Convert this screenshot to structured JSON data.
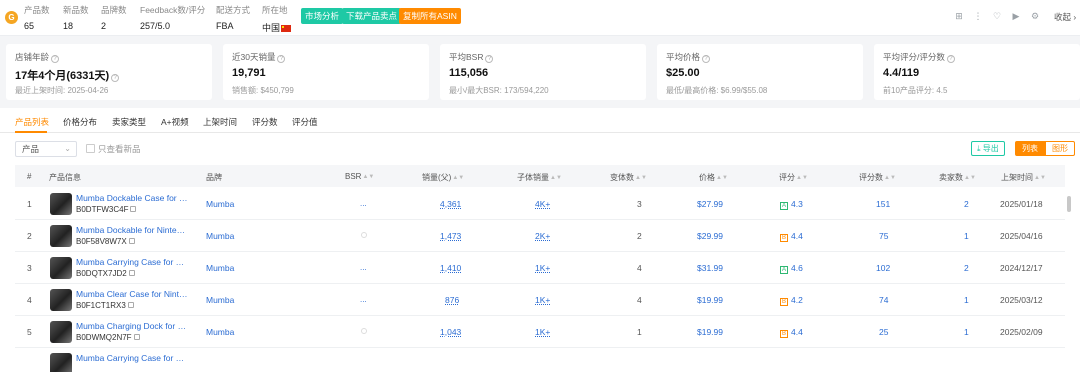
{
  "topbar": {
    "logo": "G",
    "stats": [
      {
        "label": "产品数",
        "value": "65"
      },
      {
        "label": "新品数",
        "value": "18"
      },
      {
        "label": "品牌数",
        "value": "2"
      },
      {
        "label": "Feedback数/评分",
        "value": "257/5.0"
      },
      {
        "label": "配送方式",
        "value": "FBA"
      },
      {
        "label": "所在地",
        "value": "中国"
      }
    ],
    "buttons": [
      {
        "label": "市场分析",
        "color": "#1ec9a5"
      },
      {
        "label": "下载产品卖点",
        "color": "#1ec9a5"
      },
      {
        "label": "复制所有ASIN",
        "color": "#ff8a00"
      }
    ],
    "icons": [
      "grid-icon",
      "more-vertical-icon",
      "heart-icon",
      "video-icon",
      "settings-icon"
    ],
    "collapse_label": "收起"
  },
  "cards": [
    {
      "label": "店铺年龄",
      "value": "17年4个月(6331天)",
      "sub": "最近上架时间: 2025-04-26"
    },
    {
      "label": "近30天销量",
      "value": "19,791",
      "sub": "销售额: $450,799"
    },
    {
      "label": "平均BSR",
      "value": "115,056",
      "sub": "最小/最大BSR: 173/594,220"
    },
    {
      "label": "平均价格",
      "value": "$25.00",
      "sub": "最低/最高价格: $6.99/$55.08"
    },
    {
      "label": "平均评分/评分数",
      "value": "4.4/119",
      "sub": "前10产品评分: 4.5"
    }
  ],
  "tabs": [
    "产品列表",
    "价格分布",
    "卖家类型",
    "A+视频",
    "上架时间",
    "评分数",
    "评分值"
  ],
  "filters": {
    "select_value": "产品",
    "new_only_label": "只查看新品",
    "export_label": "导出",
    "view_list": "列表",
    "view_chart": "图形"
  },
  "table": {
    "headers": [
      "#",
      "产品信息",
      "品牌",
      "BSR",
      "销量(父)",
      "子体销量",
      "变体数",
      "价格",
      "评分",
      "评分数",
      "卖家数",
      "上架时间"
    ],
    "rows": [
      {
        "idx": "1",
        "title": "Mumba Dockable Case for Nintendo Switch",
        "asin": "B0DTFW3C4F",
        "brand": "Mumba",
        "bsr": "...",
        "sales": "4,361",
        "child": "4K+",
        "variants": "3",
        "price": "$27.99",
        "badge": "A",
        "rating": "4.3",
        "reviews": "151",
        "sellers": "2",
        "date": "2025/01/18"
      },
      {
        "idx": "2",
        "title": "Mumba Dockable for Nintendo Switch",
        "asin": "B0F58V8W7X",
        "brand": "Mumba",
        "bsr": "",
        "sales": "1,473",
        "child": "2K+",
        "variants": "2",
        "price": "$29.99",
        "badge": "B",
        "rating": "4.4",
        "reviews": "75",
        "sellers": "1",
        "date": "2025/04/16"
      },
      {
        "idx": "3",
        "title": "Mumba Carrying Case for Nintendo Switch",
        "asin": "B0DQTX7JD2",
        "brand": "Mumba",
        "bsr": "...",
        "sales": "1,410",
        "child": "1K+",
        "variants": "4",
        "price": "$31.99",
        "badge": "A",
        "rating": "4.6",
        "reviews": "102",
        "sellers": "2",
        "date": "2024/12/17"
      },
      {
        "idx": "4",
        "title": "Mumba Clear Case for Nintendo Switch",
        "asin": "B0F1CT1RX3",
        "brand": "Mumba",
        "bsr": "...",
        "sales": "876",
        "child": "1K+",
        "variants": "4",
        "price": "$19.99",
        "badge": "B",
        "rating": "4.2",
        "reviews": "74",
        "sellers": "1",
        "date": "2025/03/12"
      },
      {
        "idx": "5",
        "title": "Mumba Charging Dock for Nintendo Switch",
        "asin": "B0DWMQ2N7F",
        "brand": "Mumba",
        "bsr": "",
        "sales": "1,043",
        "child": "1K+",
        "variants": "1",
        "price": "$19.99",
        "badge": "B",
        "rating": "4.4",
        "reviews": "25",
        "sellers": "1",
        "date": "2025/02/09"
      },
      {
        "idx": "6",
        "title": "Mumba Carrying Case for Nintendo Switch",
        "asin": "",
        "brand": "",
        "bsr": "",
        "sales": "",
        "child": "",
        "variants": "",
        "price": "",
        "badge": "",
        "rating": "",
        "reviews": "",
        "sellers": "",
        "date": ""
      }
    ]
  }
}
